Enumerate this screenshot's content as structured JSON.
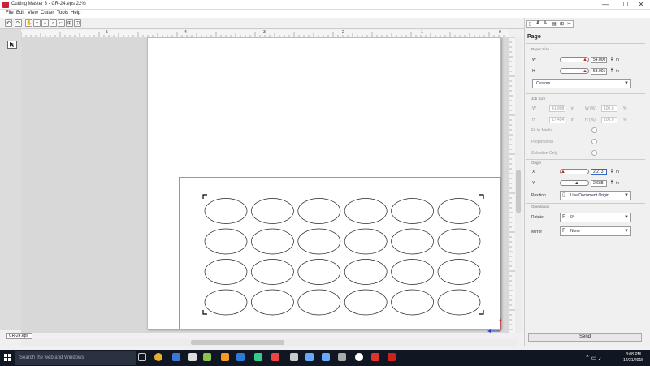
{
  "window": {
    "title": "Cutting Master 3 - CR-24.eps 22%",
    "minimize": "—",
    "maximize": "☐",
    "close": "✕"
  },
  "menu": [
    "File",
    "Edit",
    "View",
    "Cutter",
    "Tools",
    "Help"
  ],
  "ruler": {
    "h_labels": [
      "6",
      "5",
      "4",
      "3",
      "2",
      "1",
      "0"
    ]
  },
  "document_tab": "CR-24.eps",
  "panel": {
    "heading": "Page",
    "paper_size": {
      "group": "Paper Size",
      "w_label": "W",
      "w_value": "54.000",
      "w_unit": "in",
      "h_label": "H",
      "h_value": "53.001",
      "h_unit": "in",
      "preset": "Custom"
    },
    "job_size": {
      "group": "Job Size",
      "w_label": "W",
      "w_value": "41.808",
      "w_unit": "in",
      "wpct_label": "W (%)",
      "wpct_value": "100.0",
      "wpct_unit": "%",
      "h_label": "H",
      "h_value": "17.454",
      "h_unit": "in",
      "hpct_label": "H (%)",
      "hpct_value": "100.0",
      "hpct_unit": "%",
      "fit_to_media": "Fit to Media",
      "proportional": "Proportional",
      "selection_only": "Selection Only"
    },
    "origin": {
      "group": "Origin",
      "x_label": "X",
      "x_value": "2.273",
      "x_unit": "in",
      "y_label": "Y",
      "y_value": "2.688",
      "y_unit": "in",
      "position_label": "Position",
      "position_value": "Use Document Origin"
    },
    "orientation": {
      "group": "Orientation",
      "rotate_label": "Rotate",
      "rotate_value": "0°",
      "mirror_label": "Mirror",
      "mirror_value": "None"
    },
    "send_label": "Send"
  },
  "taskbar": {
    "search_placeholder": "Search the web and Windows",
    "time": "3:08 PM",
    "date": "12/31/2015"
  },
  "icons": [
    "windows-icon",
    "task-view-icon",
    "chrome-icon",
    "edge-icon",
    "store-icon",
    "illustrator-icon",
    "photoshop-icon",
    "calculator-icon",
    "acrobat-icon"
  ],
  "colors": {
    "taskbar": "#101722",
    "accent_red": "#cc2222",
    "axis_blue": "#2244cc"
  }
}
